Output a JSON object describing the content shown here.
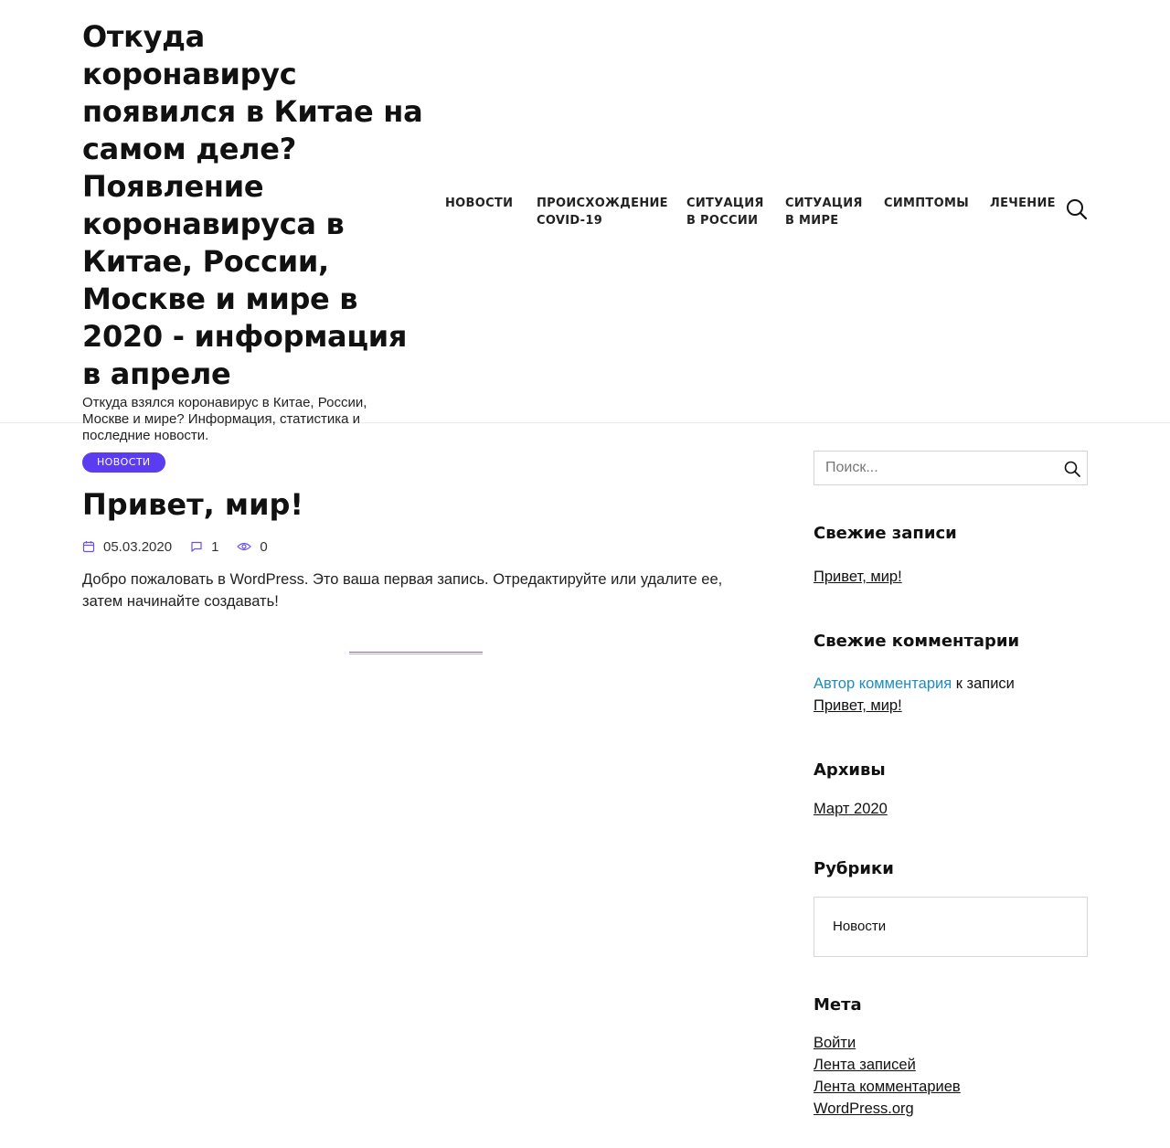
{
  "header": {
    "site_title": "Откуда коронавирус появился в Китае на самом деле? Появление коронавируса в Китае, России, Москве и мире в 2020 - информация в апреле",
    "site_description": "Откуда взялся коронавирус в Китае, России, Москве и мире? Информация, статистика и последние новости.",
    "nav": [
      {
        "line1": "НОВОСТИ",
        "line2": ""
      },
      {
        "line1": "ПРОИСХОЖДЕНИЕ",
        "line2": "COVID-19"
      },
      {
        "line1": "СИТУАЦИЯ",
        "line2": "В РОССИИ"
      },
      {
        "line1": "СИТУАЦИЯ",
        "line2": "В МИРЕ"
      },
      {
        "line1": "СИМПТОМЫ",
        "line2": ""
      },
      {
        "line1": "ЛЕЧЕНИЕ",
        "line2": ""
      }
    ],
    "search_icon": "search-icon"
  },
  "post": {
    "category": "НОВОСТИ",
    "title": "Привет, мир!",
    "date": "05.03.2020",
    "comments": "1",
    "views": "0",
    "excerpt": "Добро пожаловать в WordPress. Это ваша первая запись. Отредактируйте или удалите ее, затем начинайте создавать!"
  },
  "sidebar": {
    "search_placeholder": "Поиск...",
    "recent_posts": {
      "title": "Свежие записи",
      "items": [
        "Привет, мир!"
      ]
    },
    "recent_comments": {
      "title": "Свежие комментарии",
      "author": "Автор комментария",
      "connector": " к записи",
      "post": "Привет, мир!"
    },
    "archives": {
      "title": "Архивы",
      "items": [
        "Март 2020"
      ]
    },
    "categories": {
      "title": "Рубрики",
      "items": [
        "Новости"
      ]
    },
    "meta": {
      "title": "Мета",
      "items": [
        "Войти",
        "Лента записей",
        "Лента комментариев",
        "WordPress.org"
      ]
    }
  },
  "colors": {
    "accent": "#5b3cf0",
    "link_blue": "#1e8cbe",
    "text": "#111111"
  }
}
